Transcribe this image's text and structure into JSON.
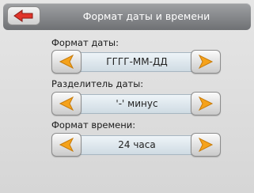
{
  "header": {
    "title": "Формат даты и времени",
    "back_icon": "back-arrow-icon",
    "back_icon_color": "#e0352b"
  },
  "settings": [
    {
      "label": "Формат даты:",
      "value": "ГГГГ-ММ-ДД"
    },
    {
      "label": "Разделитель даты:",
      "value": "'-' минус"
    },
    {
      "label": "Формат времени:",
      "value": "24 часа"
    }
  ],
  "colors": {
    "arrow_accent": "#f5a21b",
    "header": "#828488"
  }
}
